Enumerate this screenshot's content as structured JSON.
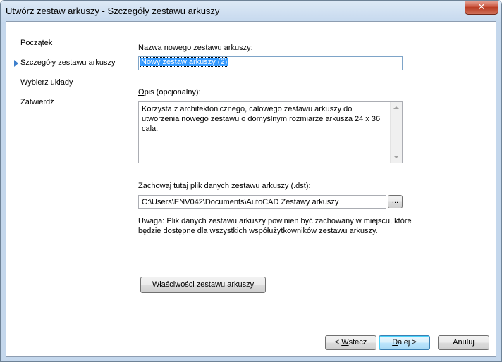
{
  "window": {
    "title": "Utwórz zestaw arkuszy - Szczegóły zestawu arkuszy",
    "close_glyph": "✕"
  },
  "nav": {
    "items": [
      {
        "label": "Początek",
        "active": false
      },
      {
        "label": "Szczegóły zestawu arkuszy",
        "active": true
      },
      {
        "label": "Wybierz układy",
        "active": false
      },
      {
        "label": "Zatwierdź",
        "active": false
      }
    ]
  },
  "form": {
    "name_label_key": "N",
    "name_label_rest": "azwa nowego zestawu arkuszy:",
    "name_value": "Nowy zestaw arkuszy (2)",
    "desc_label_key": "O",
    "desc_label_rest": "pis (opcjonalny):",
    "desc_value": "Korzysta z architektonicznego, calowego zestawu arkuszy do utworzenia nowego zestawu o domyślnym rozmiarze arkusza 24 x 36 cala.",
    "path_label_key": "Z",
    "path_label_rest": "achowaj tutaj plik danych zestawu arkuszy (.dst):",
    "path_value": "C:\\Users\\ENV042\\Documents\\AutoCAD Zestawy arkuszy",
    "browse_label": "...",
    "note": "Uwaga: Plik danych zestawu arkuszy powinien być zachowany w miejscu, które będzie dostępne dla wszystkich współużytkowników zestawu arkuszy.",
    "props_label": "Właściwości zestawu arkuszy"
  },
  "footer": {
    "back_pre": "< ",
    "back_key": "W",
    "back_rest": "stecz",
    "next_key": "D",
    "next_rest": "alej >",
    "cancel_label": "Anuluj"
  }
}
